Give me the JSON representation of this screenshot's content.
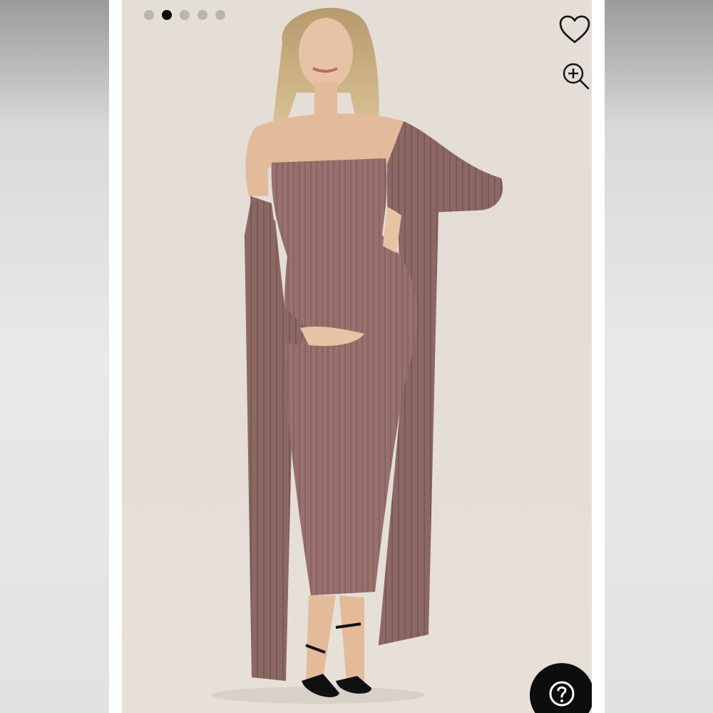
{
  "carousel": {
    "dots": [
      {
        "active": false
      },
      {
        "active": true
      },
      {
        "active": false
      },
      {
        "active": false
      },
      {
        "active": false
      }
    ]
  },
  "icons": {
    "favorite": "heart-icon",
    "zoom": "zoom-in-icon",
    "help": "question-mark-icon"
  },
  "colors": {
    "background": "#e4ded6",
    "garment": "#98706d",
    "active_dot": "#0b0b0b",
    "inactive_dot": "#b9b6b2",
    "help_button": "#0d0d0d"
  }
}
